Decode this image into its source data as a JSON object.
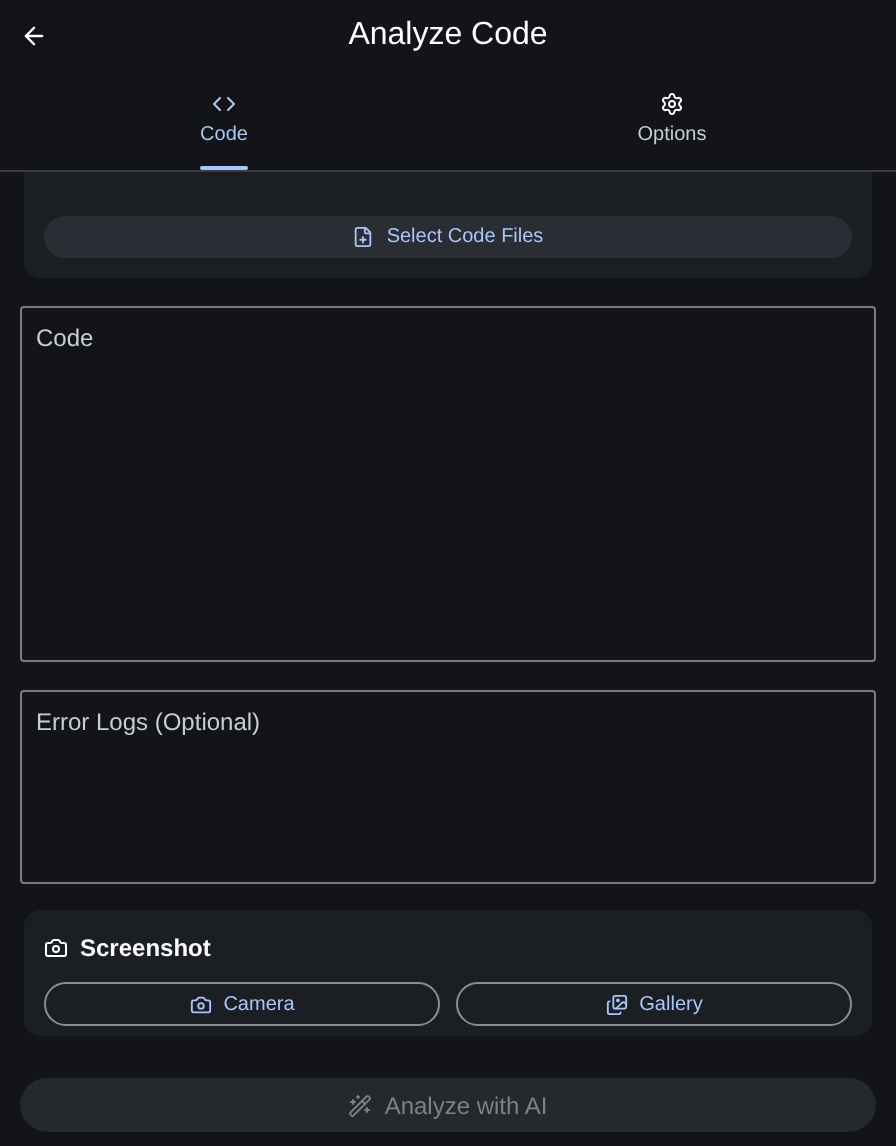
{
  "header": {
    "title": "Analyze Code"
  },
  "tabs": [
    {
      "label": "Code",
      "selected": true
    },
    {
      "label": "Options",
      "selected": false
    }
  ],
  "upload": {
    "button": "Select Code Files"
  },
  "fields": [
    {
      "placeholder": "Code"
    },
    {
      "placeholder": "Error Logs (Optional)"
    }
  ],
  "screenshot": {
    "title": "Screenshot",
    "buttons": [
      {
        "label": "Camera"
      },
      {
        "label": "Gallery"
      }
    ]
  },
  "analyze": {
    "label": "Analyze with AI",
    "disabled": true
  }
}
